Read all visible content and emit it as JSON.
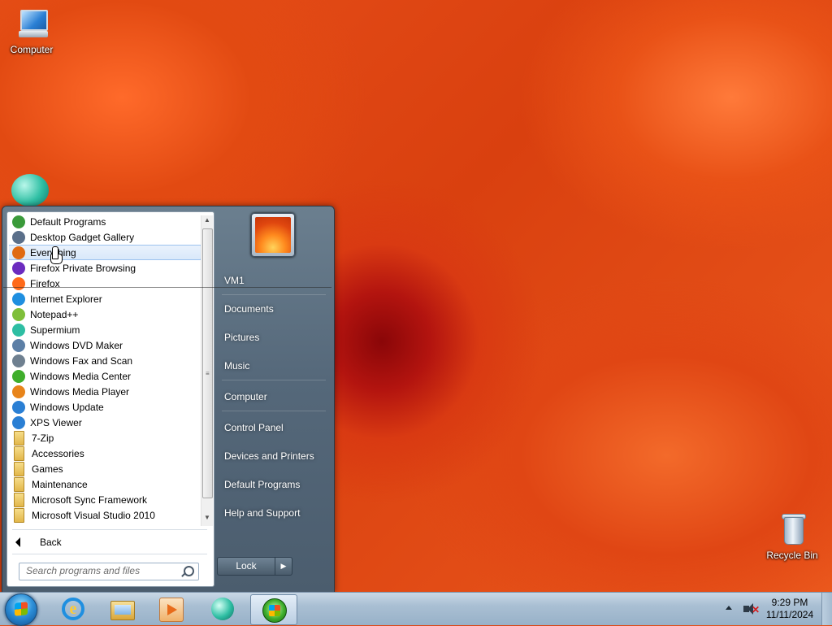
{
  "desktop": {
    "icons": [
      {
        "label": "Computer"
      },
      {
        "label": "Recycle Bin"
      }
    ]
  },
  "start_menu": {
    "programs": [
      {
        "label": "Default Programs",
        "icon": "default-programs-icon",
        "color": "#3a9a3a"
      },
      {
        "label": "Desktop Gadget Gallery",
        "icon": "gadget-gallery-icon",
        "color": "#5a6f8a"
      },
      {
        "label": "Everything",
        "icon": "everything-search-icon",
        "color": "#e06a12"
      },
      {
        "label": "Firefox Private Browsing",
        "icon": "firefox-private-icon",
        "color": "#6b2bbf"
      },
      {
        "label": "Firefox",
        "icon": "firefox-icon",
        "color": "#ff6a1a"
      },
      {
        "label": "Internet Explorer",
        "icon": "internet-explorer-icon",
        "color": "#1f8fe0"
      },
      {
        "label": "Notepad++",
        "icon": "notepad-plus-plus-icon",
        "color": "#7fbf3a"
      },
      {
        "label": "Supermium",
        "icon": "supermium-icon",
        "color": "#2ebea3"
      },
      {
        "label": "Windows DVD Maker",
        "icon": "dvd-maker-icon",
        "color": "#5c7fa6"
      },
      {
        "label": "Windows Fax and Scan",
        "icon": "fax-scan-icon",
        "color": "#6f8090"
      },
      {
        "label": "Windows Media Center",
        "icon": "media-center-icon",
        "color": "#3fae2c"
      },
      {
        "label": "Windows Media Player",
        "icon": "media-player-icon",
        "color": "#e8841a"
      },
      {
        "label": "Windows Update",
        "icon": "windows-update-icon",
        "color": "#2a7fd4"
      },
      {
        "label": "XPS Viewer",
        "icon": "xps-viewer-icon",
        "color": "#2a7fd4"
      },
      {
        "label": "7-Zip",
        "icon": "folder-icon",
        "folder": true
      },
      {
        "label": "Accessories",
        "icon": "folder-icon",
        "folder": true
      },
      {
        "label": "Games",
        "icon": "folder-icon",
        "folder": true
      },
      {
        "label": "Maintenance",
        "icon": "folder-icon",
        "folder": true
      },
      {
        "label": "Microsoft Sync Framework",
        "icon": "folder-icon",
        "folder": true
      },
      {
        "label": "Microsoft Visual Studio 2010",
        "icon": "folder-icon",
        "folder": true
      }
    ],
    "highlighted_index": 2,
    "back_label": "Back",
    "search_placeholder": "Search programs and files",
    "right_items": [
      {
        "label": "VM1"
      },
      {
        "label": "Documents"
      },
      {
        "label": "Pictures"
      },
      {
        "label": "Music"
      },
      {
        "label": "Computer"
      },
      {
        "label": "Control Panel"
      },
      {
        "label": "Devices and Printers"
      },
      {
        "label": "Default Programs"
      },
      {
        "label": "Help and Support"
      }
    ],
    "lock_label": "Lock"
  },
  "taskbar": {
    "time": "9:29 PM",
    "date": "11/11/2024",
    "pinned": [
      {
        "name": "internet-explorer-taskbar-button"
      },
      {
        "name": "windows-explorer-taskbar-button"
      },
      {
        "name": "windows-media-player-taskbar-button"
      },
      {
        "name": "supermium-taskbar-button"
      },
      {
        "name": "windows-media-center-taskbar-button",
        "active": true
      }
    ]
  }
}
